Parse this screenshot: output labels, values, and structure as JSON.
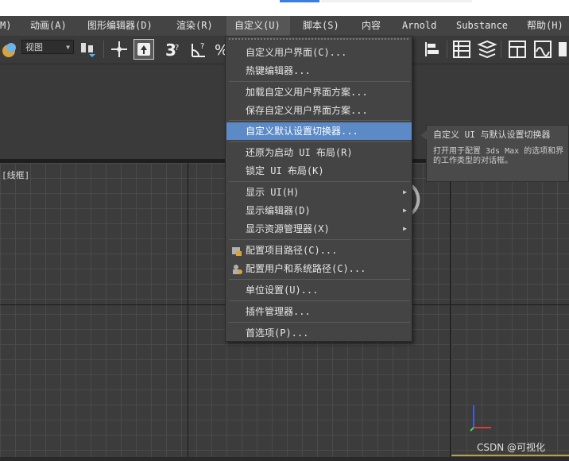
{
  "menubar": {
    "items": [
      "M)",
      "动画(A)",
      "图形编辑器(D)",
      "渲染(R)",
      "自定义(U)",
      "脚本(S)",
      "内容",
      "Arnold",
      "Substance",
      "帮助(H)"
    ]
  },
  "toolbar": {
    "view_select": "视图"
  },
  "viewport": {
    "label": "[线框]"
  },
  "menu": {
    "items": [
      {
        "label": "自定义用户界面(C)..."
      },
      {
        "label": "热键编辑器..."
      },
      {
        "label": "加载自定义用户界面方案..."
      },
      {
        "label": "保存自定义用户界面方案..."
      },
      {
        "label": "自定义默认设置切换器..."
      },
      {
        "label": "还原为启动 UI 布局(R)"
      },
      {
        "label": "锁定 UI 布局(K)"
      },
      {
        "label": "显示 UI(H)"
      },
      {
        "label": "显示编辑器(D)"
      },
      {
        "label": "显示资源管理器(X)"
      },
      {
        "label": "配置项目路径(C)..."
      },
      {
        "label": "配置用户和系统路径(C)..."
      },
      {
        "label": "单位设置(U)..."
      },
      {
        "label": "插件管理器..."
      },
      {
        "label": "首选项(P)..."
      }
    ]
  },
  "tooltip": {
    "title": "自定义 UI 与默认设置切换器",
    "line1": "打开用于配置 3ds Max 的选项和界",
    "line2": "的工作类型的对话框。"
  },
  "watermark": "CSDN @可视化",
  "colors": {
    "menu_bg": "#444444",
    "highlight": "#5b8ac6",
    "viewport_bg": "#3c3c3c",
    "accent_blue": "#3b7de0"
  }
}
